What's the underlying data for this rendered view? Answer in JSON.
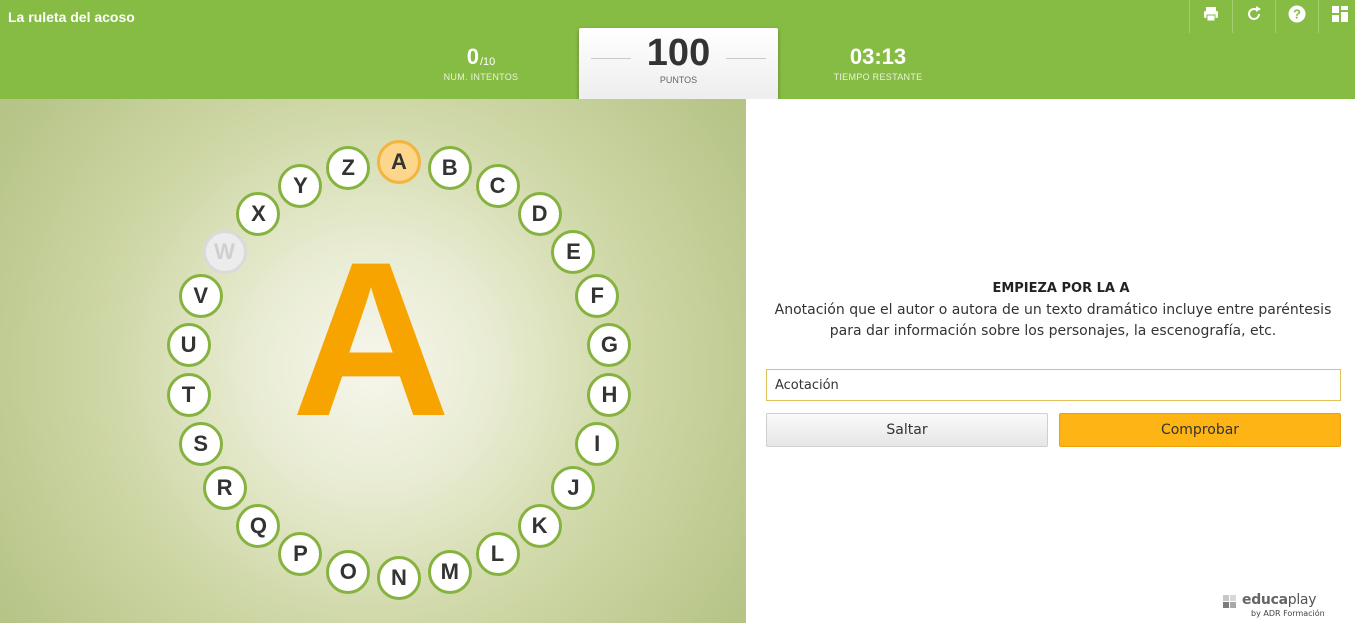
{
  "app": {
    "title": "La ruleta del acoso"
  },
  "toolbar": {
    "buttons": [
      {
        "name": "print-button",
        "icon": "printer-icon"
      },
      {
        "name": "restart-button",
        "icon": "refresh-icon"
      },
      {
        "name": "help-button",
        "icon": "question-icon"
      },
      {
        "name": "menu-button",
        "icon": "grid-icon"
      }
    ]
  },
  "stats": {
    "attempts_value": "0",
    "attempts_total": "/10",
    "attempts_label": "NUM. INTENTOS",
    "points_value": "100",
    "points_label": "PUNTOS",
    "time_value": "03:13",
    "time_label": "TIEMPO RESTANTE"
  },
  "wheel": {
    "current_letter": "A",
    "letters": [
      {
        "char": "A",
        "state": "active"
      },
      {
        "char": "B",
        "state": "pending"
      },
      {
        "char": "C",
        "state": "pending"
      },
      {
        "char": "D",
        "state": "pending"
      },
      {
        "char": "E",
        "state": "pending"
      },
      {
        "char": "F",
        "state": "pending"
      },
      {
        "char": "G",
        "state": "pending"
      },
      {
        "char": "H",
        "state": "pending"
      },
      {
        "char": "I",
        "state": "pending"
      },
      {
        "char": "J",
        "state": "pending"
      },
      {
        "char": "K",
        "state": "pending"
      },
      {
        "char": "L",
        "state": "pending"
      },
      {
        "char": "M",
        "state": "pending"
      },
      {
        "char": "N",
        "state": "pending"
      },
      {
        "char": "O",
        "state": "pending"
      },
      {
        "char": "P",
        "state": "pending"
      },
      {
        "char": "Q",
        "state": "pending"
      },
      {
        "char": "R",
        "state": "pending"
      },
      {
        "char": "S",
        "state": "pending"
      },
      {
        "char": "T",
        "state": "pending"
      },
      {
        "char": "U",
        "state": "pending"
      },
      {
        "char": "V",
        "state": "pending"
      },
      {
        "char": "W",
        "state": "skipped"
      },
      {
        "char": "X",
        "state": "pending"
      },
      {
        "char": "Y",
        "state": "pending"
      },
      {
        "char": "Z",
        "state": "pending"
      }
    ]
  },
  "question": {
    "title": "EMPIEZA POR LA A",
    "text": "Anotación que el autor o autora de un texto dramático incluye entre paréntesis para dar información sobre los personajes, la escenografía, etc.",
    "answer_value": "Acotación",
    "skip_label": "Saltar",
    "check_label": "Comprobar"
  },
  "brand": {
    "name_a": "educa",
    "name_b": "play",
    "sub": "by ADR Formación"
  },
  "colors": {
    "green": "#86bc43",
    "orange": "#f7a400",
    "button_orange": "#fdb414"
  }
}
